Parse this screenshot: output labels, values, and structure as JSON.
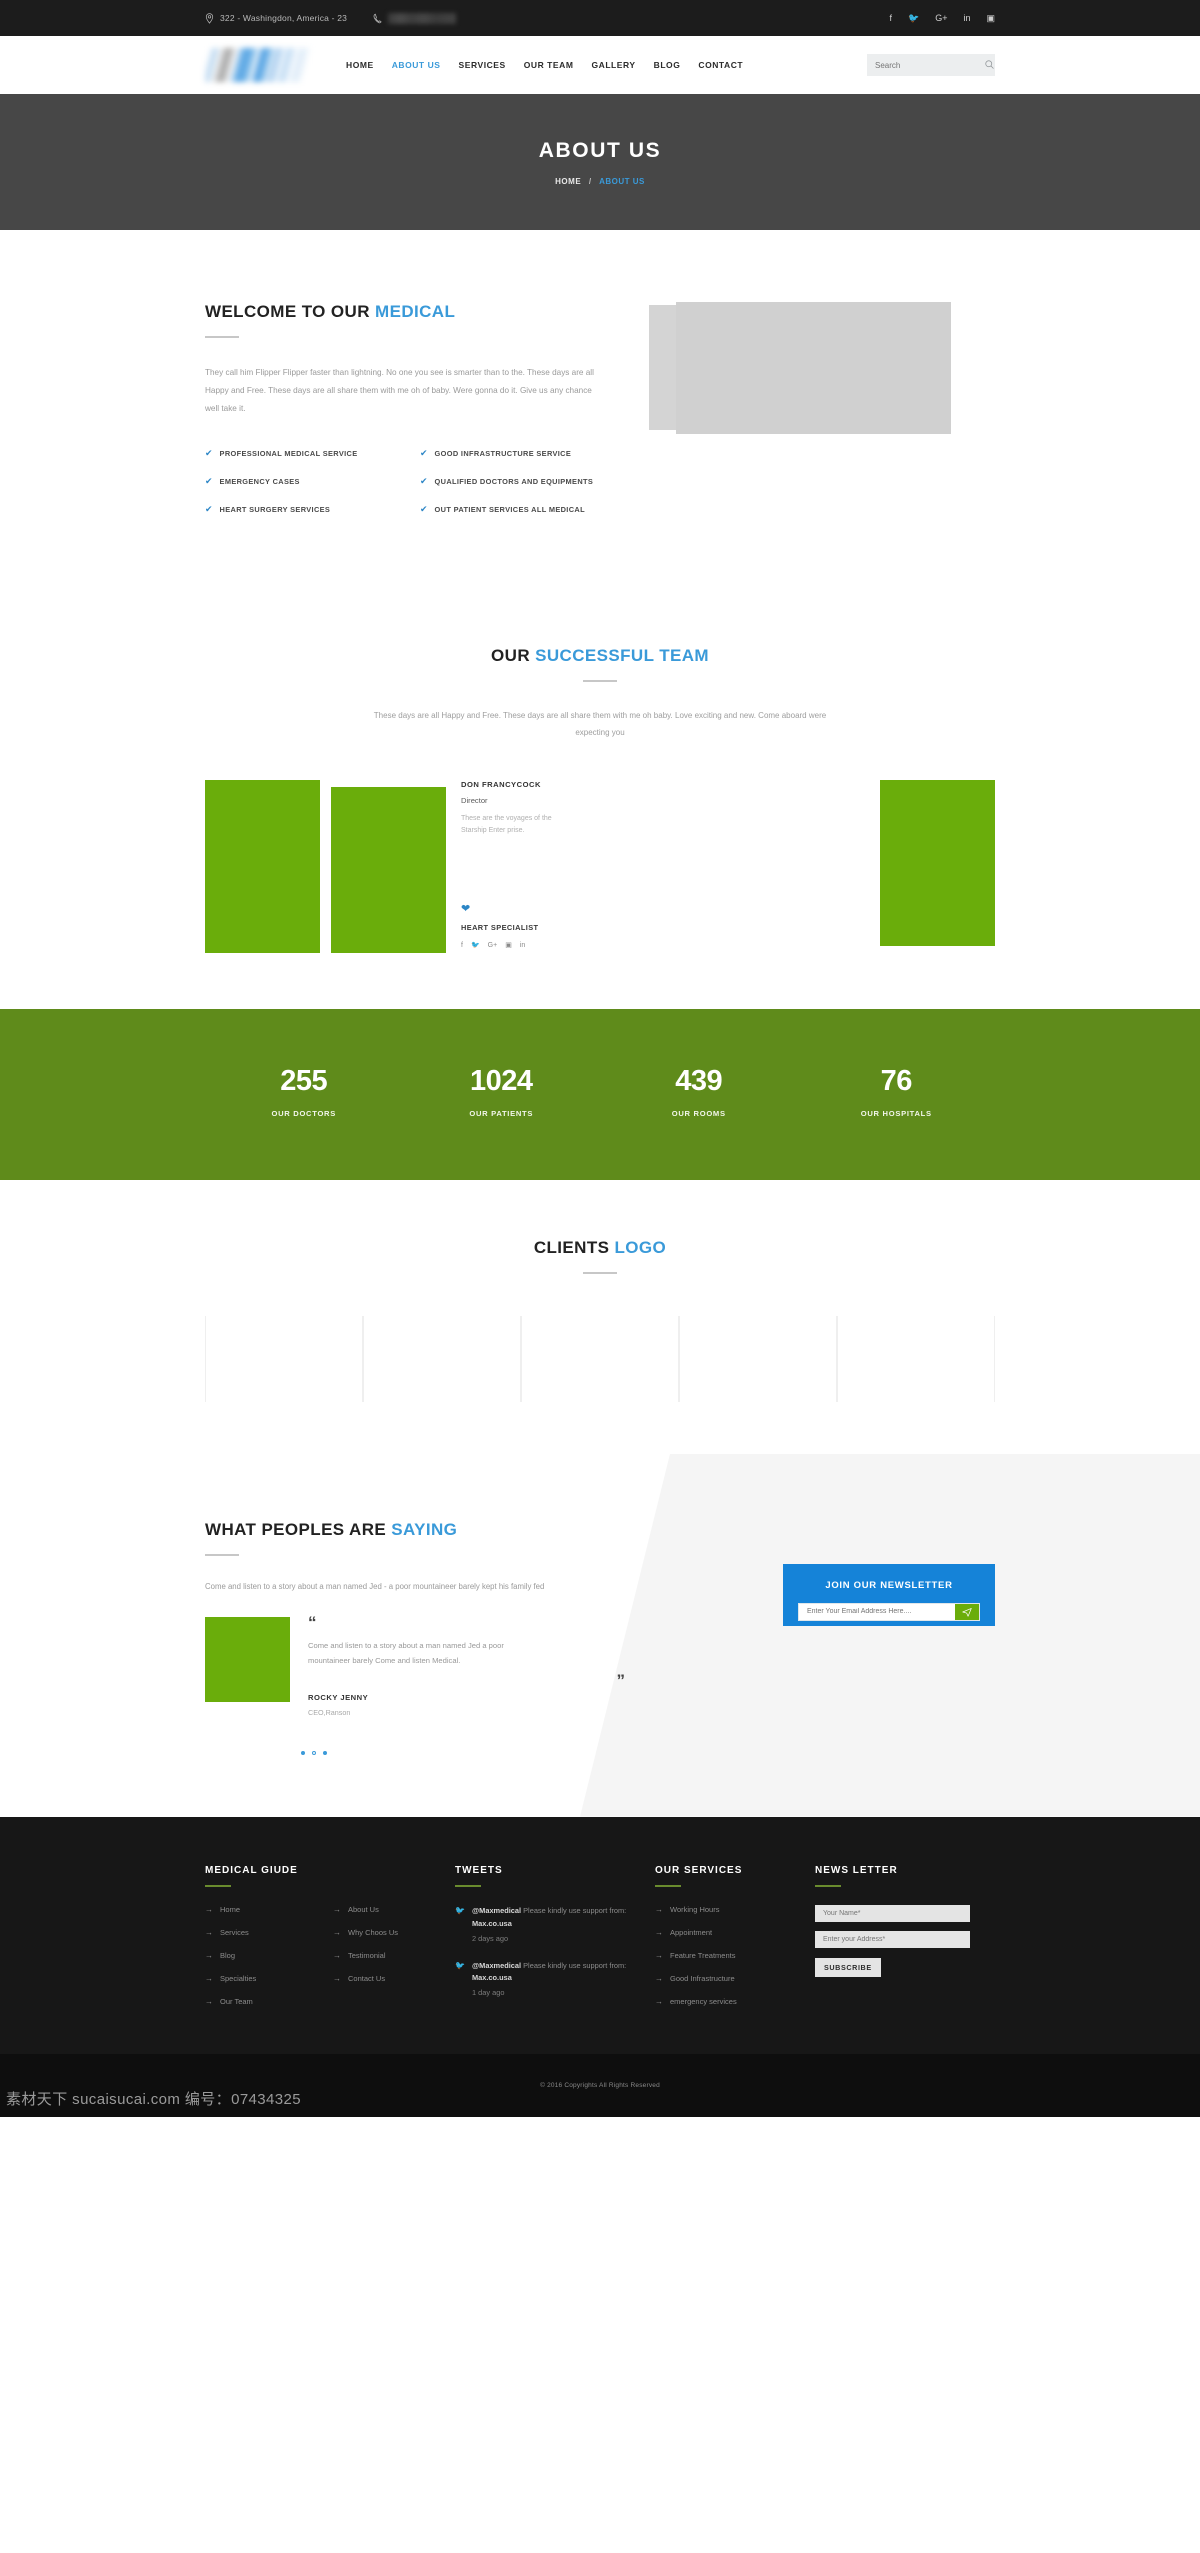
{
  "topbar": {
    "address": "322 - Washingdon, America - 23",
    "phone_blurred": true,
    "location_icon": "map-pin-icon",
    "phone_icon": "phone-icon",
    "social": [
      {
        "name": "facebook",
        "glyph": "f"
      },
      {
        "name": "twitter",
        "glyph": "🐦"
      },
      {
        "name": "google-plus",
        "glyph": "G+"
      },
      {
        "name": "linkedin",
        "glyph": "in"
      },
      {
        "name": "instagram",
        "glyph": "▣"
      }
    ]
  },
  "nav": {
    "logo_blurred": true,
    "items": [
      {
        "label": "HOME",
        "active": false
      },
      {
        "label": "ABOUT US",
        "active": true
      },
      {
        "label": "SERVICES",
        "active": false
      },
      {
        "label": "OUR TEAM",
        "active": false
      },
      {
        "label": "GALLERY",
        "active": false
      },
      {
        "label": "BLOG",
        "active": false
      },
      {
        "label": "CONTACT",
        "active": false
      }
    ],
    "search_placeholder": "Search",
    "search_value": "",
    "accent": "#3a9ad9"
  },
  "banner": {
    "title": "ABOUT US",
    "crumb_home": "HOME",
    "crumb_sep": "/",
    "crumb_current": "ABOUT US"
  },
  "welcome": {
    "title_main": "WELCOME TO OUR ",
    "title_hl": "MEDICAL",
    "paragraph": "They call him Flipper Flipper faster than lightning. No one you see is smarter than to the. These days are all Happy and Free. These days are all share them with me oh of baby. Were gonna do it. Give us any chance well take it.",
    "features": [
      "PROFESSIONAL MEDICAL SERVICE",
      "GOOD INFRASTRUCTURE SERVICE",
      "EMERGENCY CASES",
      "QUALIFIED DOCTORS AND EQUIPMENTS",
      "HEART SURGERY SERVICES",
      "OUT PATIENT SERVICES ALL MEDICAL"
    ],
    "check_glyph": "✔"
  },
  "team": {
    "title_main": "OUR ",
    "title_hl": "SUCCESSFUL TEAM",
    "lead": "These days are all Happy and Free. These days are all share them with me oh baby. Love exciting and new. Come aboard were expecting you",
    "member": {
      "name": "DON FRANCYCOCK",
      "role": "Director",
      "desc": "These are the voyages of the Starship Enter prise.",
      "heart_icon": "heart-icon",
      "specialty": "HEART SPECIALIST",
      "social": [
        {
          "name": "facebook",
          "glyph": "f"
        },
        {
          "name": "twitter",
          "glyph": "🐦"
        },
        {
          "name": "google-plus",
          "glyph": "G+"
        },
        {
          "name": "instagram",
          "glyph": "▣"
        },
        {
          "name": "linkedin",
          "glyph": "in"
        }
      ]
    },
    "photo_color": "#6aad0b"
  },
  "counters": {
    "bg": "#5f8b1b",
    "items": [
      {
        "value": "255",
        "label": "OUR DOCTORS"
      },
      {
        "value": "1024",
        "label": "OUR PATIENTS"
      },
      {
        "value": "439",
        "label": "OUR ROOMS"
      },
      {
        "value": "76",
        "label": "OUR HOSPITALS"
      }
    ]
  },
  "clients": {
    "title_main": "CLIENTS ",
    "title_hl": "LOGO",
    "slots": 5
  },
  "testimonials": {
    "title_main": "WHAT PEOPLES ARE ",
    "title_hl": "SAYING",
    "lead": "Come and listen to a story about a man named Jed - a poor mountaineer barely kept his family fed",
    "quote_open": "“",
    "quote_close": "”",
    "quote": "Come and listen to a story about a man named Jed a poor mountaineer barely Come and listen Medical.",
    "author": "ROCKY JENNY",
    "position": "CEO,Ranson",
    "dots": 3,
    "active_dot": 1
  },
  "newsletter": {
    "heading": "JOIN OUR NEWSLETTER",
    "placeholder": "Enter Your Email Address Here....",
    "value": "",
    "send_icon": "paper-plane-icon",
    "bg": "#1583d8",
    "send_bg": "#6aad0b"
  },
  "footer": {
    "guide": {
      "heading": "MEDICAL GIUDE",
      "links": [
        "Home",
        "About Us",
        "Services",
        "Why Choos Us",
        "Blog",
        "Testimonial",
        "Specialties",
        "Contact Us",
        "Our Team"
      ]
    },
    "tweets": {
      "heading": "TWEETS",
      "items": [
        {
          "handle": "@Maxmedical",
          "text": " Please kindly use support from: ",
          "site": "Max.co.usa",
          "time": "2 days ago"
        },
        {
          "handle": "@Maxmedical",
          "text": " Please kindly use support from: ",
          "site": "Max.co.usa",
          "time": "1 day ago"
        }
      ]
    },
    "services": {
      "heading": "OUR SERVICES",
      "links": [
        "Working Hours",
        "Appointment",
        "Feature Treatments",
        "Good Infrastructure",
        "emergency services"
      ]
    },
    "newsletter": {
      "heading": "NEWS LETTER",
      "name_placeholder": "Your Name*",
      "address_placeholder": "Enter your Address*",
      "name_value": "",
      "address_value": "",
      "button": "SUBSCRIBE"
    },
    "copyright": "© 2016 Copyrights All Rights Reserved",
    "watermark": "素材天下 sucaisucai.com 编号：07434325"
  }
}
